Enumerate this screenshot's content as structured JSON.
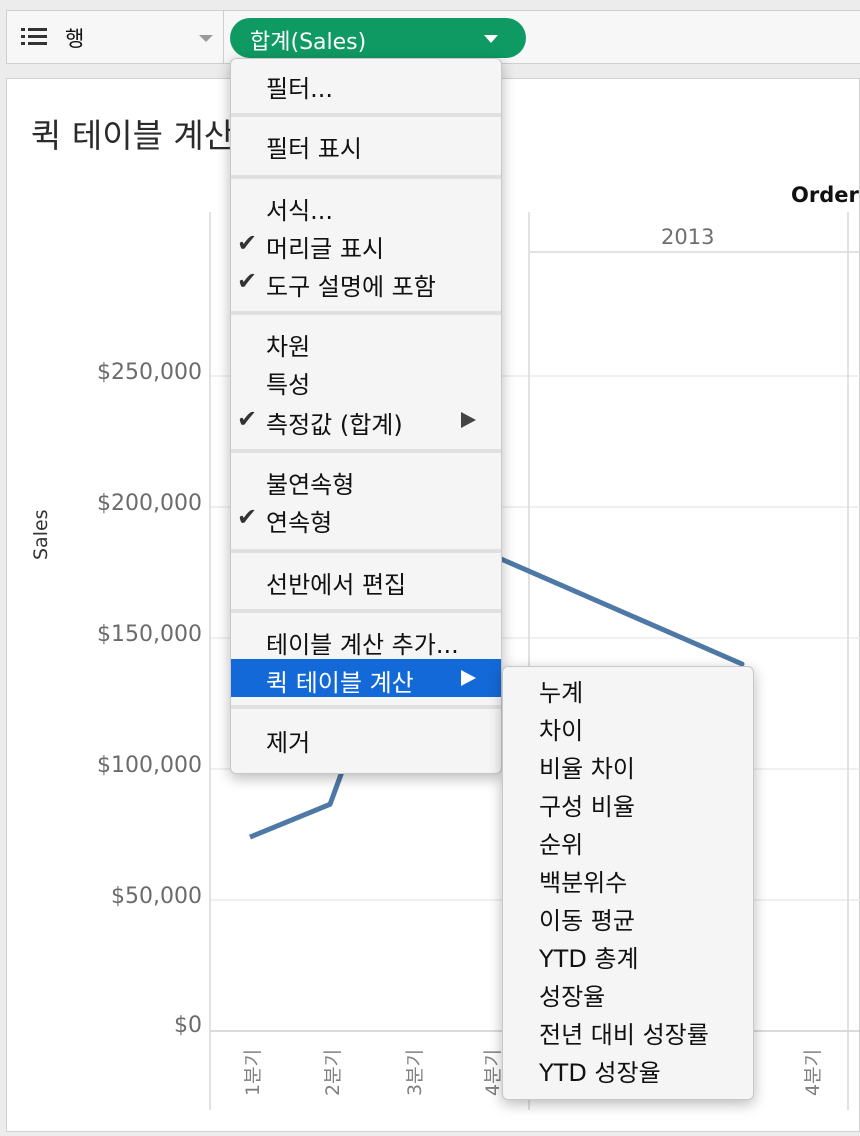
{
  "shelf": {
    "rows_label": "행",
    "pill_label": "합계(Sales)"
  },
  "view": {
    "title": "퀵 테이블 계산",
    "column_header_title": "Order",
    "year_label": "2013"
  },
  "chart_data": {
    "type": "line",
    "ylabel": "Sales",
    "yticks": [
      "$250,000",
      "$200,000",
      "$150,000",
      "$100,000",
      "$50,000",
      "$0"
    ],
    "ylim": [
      0,
      250000
    ],
    "x_tick_labels": [
      "1분기",
      "2분기",
      "3분기",
      "4분기",
      "4분기"
    ],
    "series": [
      {
        "x": [
          "1분기",
          "2분기"
        ],
        "values": [
          74000,
          86500
        ]
      },
      {
        "x": [
          "4분기"
        ],
        "values": [
          182000
        ]
      }
    ],
    "line_color": "#4e79a7",
    "grid": true
  },
  "menu": {
    "items": [
      {
        "label": "필터...",
        "checked": false
      },
      {
        "label": "필터 표시",
        "checked": false
      },
      {
        "label": "서식...",
        "checked": false
      },
      {
        "label": "머리글 표시",
        "checked": true
      },
      {
        "label": "도구 설명에 포함",
        "checked": true
      },
      {
        "label": "차원",
        "checked": false
      },
      {
        "label": "특성",
        "checked": false
      },
      {
        "label": "측정값 (합계)",
        "checked": true,
        "submenu": true
      },
      {
        "label": "불연속형",
        "checked": false
      },
      {
        "label": "연속형",
        "checked": true
      },
      {
        "label": "선반에서 편집",
        "checked": false
      },
      {
        "label": "테이블 계산 추가...",
        "checked": false
      },
      {
        "label": "퀵 테이블 계산",
        "checked": false,
        "submenu": true,
        "highlighted": true
      },
      {
        "label": "제거",
        "checked": false
      }
    ],
    "check_glyph": "✔"
  },
  "submenu": {
    "items": [
      "누계",
      "차이",
      "비율 차이",
      "구성 비율",
      "순위",
      "백분위수",
      "이동 평균",
      "YTD 총계",
      "성장율",
      "전년 대비 성장률",
      "YTD 성장율"
    ]
  }
}
